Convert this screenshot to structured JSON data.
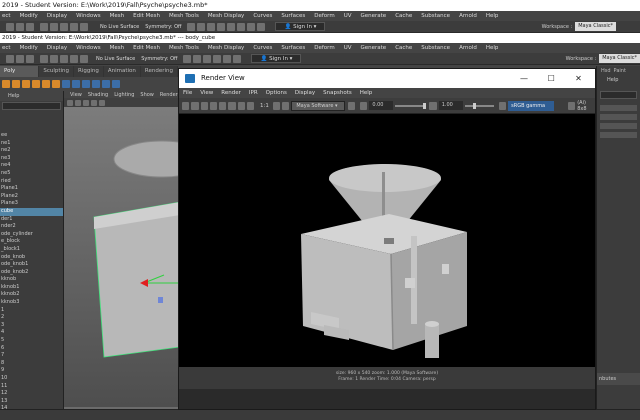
{
  "maya": {
    "title1": "2019 - Student Version: E:\\Work\\2019\\Fall\\Psyche\\psyche3.mb*",
    "title2": "2019 - Student Version: E:\\Work\\2019\\Fall\\Psyche\\psyche3.mb* --- body_cube",
    "menu": [
      "ect",
      "Modify",
      "Display",
      "Windows",
      "Mesh",
      "Edit Mesh",
      "Mesh Tools",
      "Mesh Display",
      "Curves",
      "Surfaces",
      "Deform",
      "UV",
      "Generate",
      "Cache",
      "Substance",
      "Arnold",
      "Help"
    ],
    "menu2": [
      "ect",
      "Modify",
      "Display",
      "Windows",
      "Mesh",
      "Edit Mesh",
      "Mesh Tools",
      "Mesh Display",
      "Curves",
      "Surfaces",
      "Deform",
      "UV",
      "Generate",
      "Cache",
      "Substance",
      "Arnold",
      "Help"
    ],
    "live_surface": "No Live Surface",
    "symmetry": "Symmetry: Off",
    "sign_in": "Sign In",
    "workspace_label": "Workspace :",
    "workspace_value": "Maya Classic*",
    "shelf_tabs": [
      "Poly Modeling",
      "Sculpting",
      "Rigging",
      "Animation",
      "Rendering"
    ],
    "viewport_menu": [
      "View",
      "Shading",
      "Lighting",
      "Show",
      "Renderer"
    ],
    "outliner_help": "Help",
    "outliner_items": [
      "ee",
      "ne1",
      "ne2",
      "ne3",
      "ne4",
      "ne5",
      "ried",
      "Plane1",
      "Plane2",
      "Plane3",
      "cube",
      "der1",
      "nder2",
      "ode_cylinder",
      "e_block",
      "_block1",
      "ode_knob",
      "ode_knob1",
      "ode_knob2",
      "kknob",
      "kknob1",
      "kknob2",
      "kknob3",
      "1",
      "2",
      "3",
      "4",
      "5",
      "6",
      "7",
      "8",
      "9",
      "10",
      "11",
      "12",
      "13",
      "14"
    ],
    "outliner_selected_index": 10,
    "right_help": "Help",
    "right_tabs": [
      "Hsd",
      "Paint"
    ],
    "right_bottom": "nbutes"
  },
  "render_view": {
    "title": "Render View",
    "menu": [
      "File",
      "View",
      "Render",
      "IPR",
      "Options",
      "Display",
      "Snapshots",
      "Help"
    ],
    "ratio": "1:1",
    "renderer": "Maya Software",
    "exposure": "0.00",
    "gamma": "1.00",
    "colorspace": "sRGB gamma",
    "res_label": "(Ai) 8x8",
    "status_line1": "size: 960 x 540  zoom: 1.000          (Maya Software)",
    "status_line2": "Frame: 1        Render Time: 0:04        Camera: persp",
    "window_controls": [
      "—",
      "☐",
      "✕"
    ]
  },
  "colors": {
    "accent_selection": "#5285a6",
    "render_background": "#000000",
    "colorspace_blue": "#2f5d93"
  }
}
